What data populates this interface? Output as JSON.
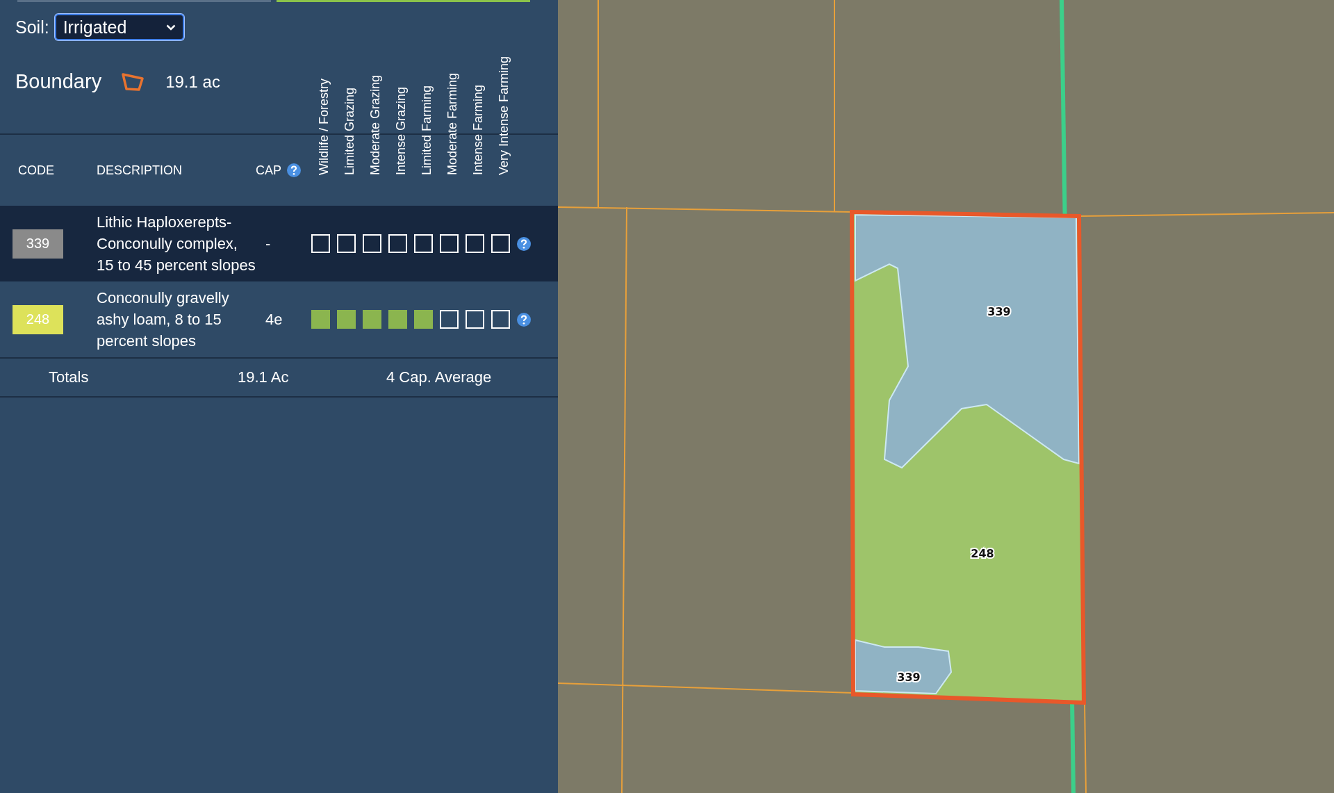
{
  "soil": {
    "label": "Soil:",
    "value": "Irrigated"
  },
  "boundary": {
    "label": "Boundary",
    "area": "19.1 ac"
  },
  "table": {
    "columns": [
      "CODE",
      "DESCRIPTION",
      "CAP"
    ],
    "classes": [
      "Wildlife / Forestry",
      "Limited Grazing",
      "Moderate Grazing",
      "Intense Grazing",
      "Limited Farming",
      "Moderate Farming",
      "Intense Farming",
      "Very Intense Farming"
    ],
    "rows": [
      {
        "code": "339",
        "color": "#8a8a8a",
        "description": "Lithic Haploxerepts-Conconully complex, 15 to 45 percent slopes",
        "cap": "-",
        "selected": true,
        "suitability": [
          {
            "on": false
          },
          {
            "on": false
          },
          {
            "on": false
          },
          {
            "on": false
          },
          {
            "on": false
          },
          {
            "on": false
          },
          {
            "on": false
          },
          {
            "on": false
          }
        ]
      },
      {
        "code": "248",
        "color": "#dde25a",
        "description": "Conconully gravelly ashy loam, 8 to 15 percent slopes",
        "cap": "4e",
        "selected": false,
        "suitability": [
          {
            "on": true
          },
          {
            "on": true
          },
          {
            "on": true
          },
          {
            "on": true
          },
          {
            "on": true
          },
          {
            "on": false
          },
          {
            "on": false
          },
          {
            "on": false
          }
        ]
      }
    ],
    "totals": {
      "label": "Totals",
      "area": "19.1 Ac",
      "average": "4 Cap. Average"
    }
  },
  "map": {
    "labels": [
      {
        "text": "339"
      },
      {
        "text": "248"
      },
      {
        "text": "339"
      }
    ]
  }
}
